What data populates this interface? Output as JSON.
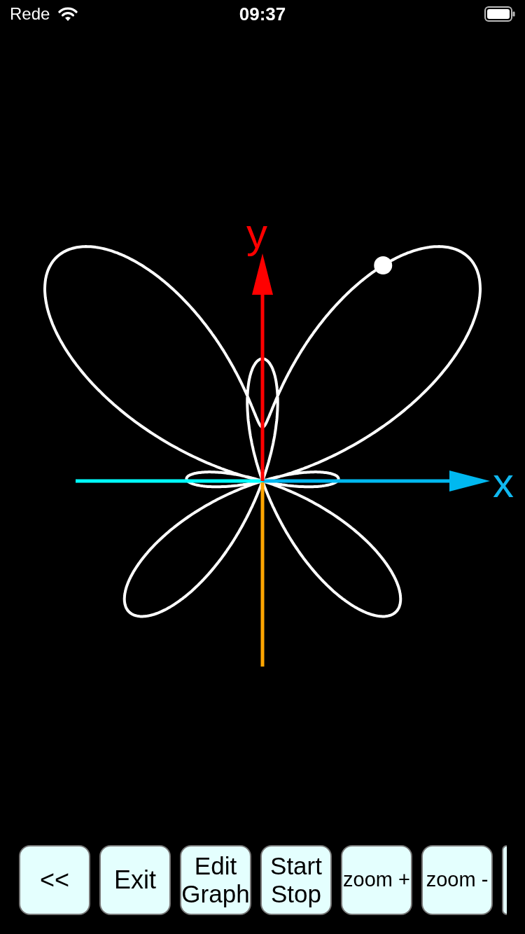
{
  "status_bar": {
    "carrier": "Rede",
    "time": "09:37"
  },
  "graph": {
    "axis_labels": {
      "x": "x",
      "y": "y"
    }
  },
  "buttons": [
    {
      "lines": [
        "<<"
      ]
    },
    {
      "lines": [
        "Exit"
      ]
    },
    {
      "lines": [
        "Edit",
        "Graph"
      ]
    },
    {
      "lines": [
        "Start",
        "Stop"
      ]
    },
    {
      "lines": [
        "zoom +"
      ]
    },
    {
      "lines": [
        "zoom -"
      ]
    }
  ],
  "button_bar": {
    "overflow_button_visible": true
  }
}
